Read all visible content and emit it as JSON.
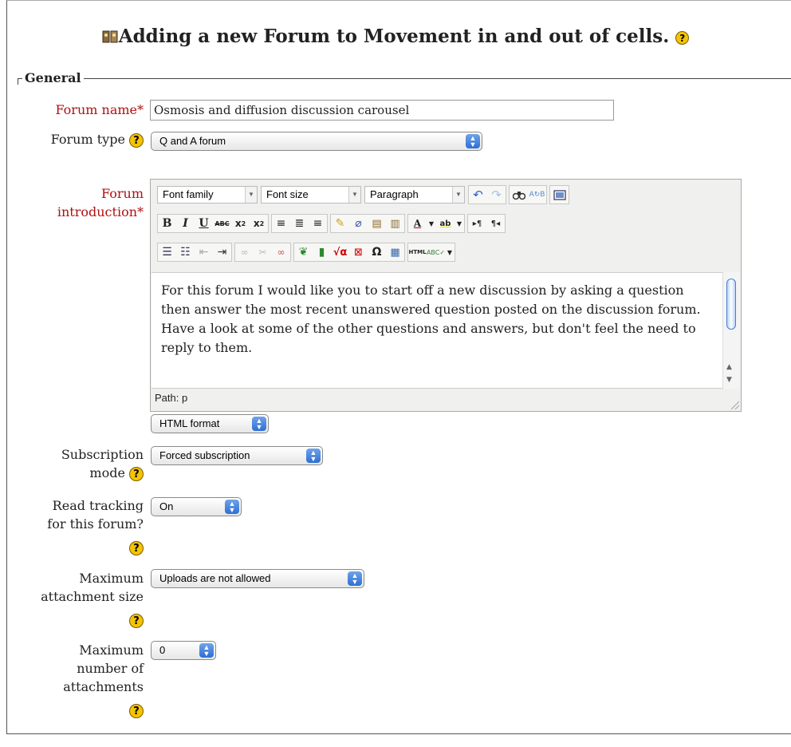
{
  "heading": {
    "title": "Adding a new Forum to Movement in and out of cells."
  },
  "section": {
    "legend": "General"
  },
  "fields": {
    "forum_name": {
      "label": "Forum name",
      "value": "Osmosis and diffusion discussion carousel"
    },
    "forum_type": {
      "label": "Forum type",
      "value": "Q and A forum"
    },
    "intro": {
      "label_line1": "Forum",
      "label_line2": "introduction",
      "text": "For this forum I would like you to start off a new discussion by asking a question then answer the most recent unanswered question posted on the discussion forum.  Have a look at some of the other questions and answers, but don't feel the need to reply to them.",
      "path": "Path: p",
      "format": "HTML format"
    },
    "subscription": {
      "label_line1": "Subscription",
      "label_line2": "mode",
      "value": "Forced subscription"
    },
    "tracking": {
      "label_line1": "Read tracking",
      "label_line2": "for this forum?",
      "value": "On"
    },
    "max_size": {
      "label_line1": "Maximum",
      "label_line2": "attachment size",
      "value": "Uploads are not allowed"
    },
    "max_num": {
      "label_line1": "Maximum",
      "label_line2": "number of",
      "label_line3": "attachments",
      "value": "0"
    }
  },
  "editor": {
    "font_family": "Font family",
    "font_size": "Font size",
    "paragraph": "Paragraph"
  },
  "required_mark": "*",
  "help_glyph": "?"
}
